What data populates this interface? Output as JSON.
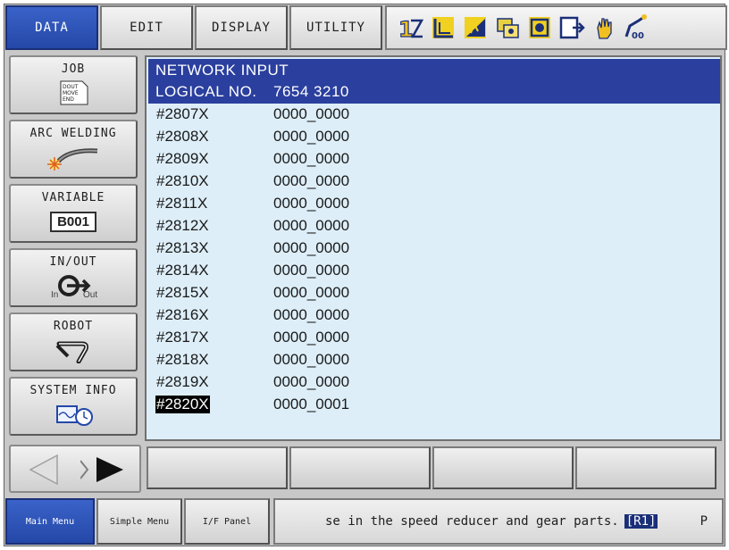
{
  "top_menu": {
    "tabs": [
      {
        "label": "DATA",
        "active": true
      },
      {
        "label": "EDIT",
        "active": false
      },
      {
        "label": "DISPLAY",
        "active": false
      },
      {
        "label": "UTILITY",
        "active": false
      }
    ],
    "status_icons": [
      "cycle-mode-icon",
      "coordinate-frame-icon",
      "speed-level-icon",
      "security-mode-icon",
      "teach-mode-icon",
      "play-step-icon",
      "servo-hand-icon",
      "robot-group-icon"
    ]
  },
  "left_menu": {
    "items": [
      {
        "label": "JOB",
        "icon": "job-document-icon",
        "icon_text": [
          "DOUT",
          "MOVE",
          "END"
        ]
      },
      {
        "label": "ARC WELDING",
        "icon": "arc-welding-torch-icon"
      },
      {
        "label": "VARIABLE",
        "icon": "variable-box-icon",
        "icon_text": "B001"
      },
      {
        "label": "IN/OUT",
        "icon": "in-out-icon",
        "icon_in": "In",
        "icon_out": "Out"
      },
      {
        "label": "ROBOT",
        "icon": "robot-arm-icon"
      },
      {
        "label": "SYSTEM INFO",
        "icon": "system-info-icon"
      }
    ]
  },
  "panel": {
    "title": "NETWORK INPUT",
    "logical_label": "LOGICAL NO.",
    "logical_value": "7654 3210",
    "rows": [
      {
        "addr": "#2807X",
        "value": "0000_0000"
      },
      {
        "addr": "#2808X",
        "value": "0000_0000"
      },
      {
        "addr": "#2809X",
        "value": "0000_0000"
      },
      {
        "addr": "#2810X",
        "value": "0000_0000"
      },
      {
        "addr": "#2811X",
        "value": "0000_0000"
      },
      {
        "addr": "#2812X",
        "value": "0000_0000"
      },
      {
        "addr": "#2813X",
        "value": "0000_0000"
      },
      {
        "addr": "#2814X",
        "value": "0000_0000"
      },
      {
        "addr": "#2815X",
        "value": "0000_0000"
      },
      {
        "addr": "#2816X",
        "value": "0000_0000"
      },
      {
        "addr": "#2817X",
        "value": "0000_0000"
      },
      {
        "addr": "#2818X",
        "value": "0000_0000"
      },
      {
        "addr": "#2819X",
        "value": "0000_0000"
      },
      {
        "addr": "#2820X",
        "value": "0000_0001",
        "selected": true
      }
    ]
  },
  "nav": {
    "left_arrow": "left-arrow-icon",
    "right_arrow": "right-arrow-icon"
  },
  "status_bar": {
    "main_menu": "Main Menu",
    "simple_menu": "Simple Menu",
    "if_panel": "I/F Panel",
    "message": "se in the speed reducer and gear parts.",
    "message_badge": "[R1]",
    "page_indicator": "P"
  },
  "colors": {
    "accent_blue": "#2448a8",
    "header_blue": "#2a3f9e",
    "list_bg": "#ddeef8"
  }
}
